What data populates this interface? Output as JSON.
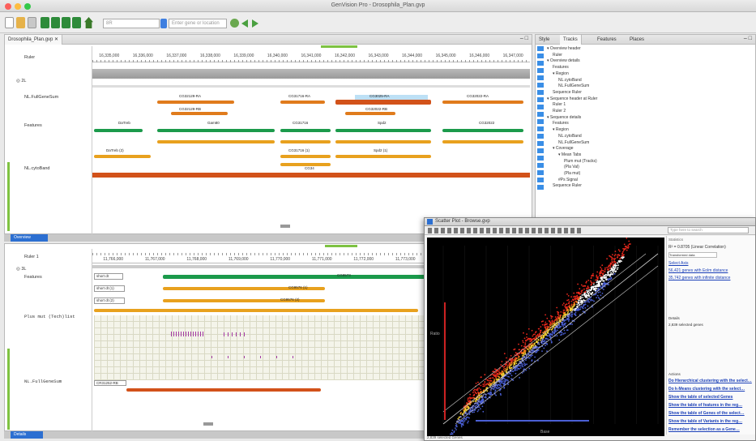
{
  "window": {
    "title": "GenVision Pro - Drosophila_Plan.gvp"
  },
  "toolbar": {
    "search_placeholder": "Enter gene or location",
    "combo_value": "8R"
  },
  "top_panel": {
    "tab_label": "Drosophila_Plan.gvp",
    "ruler_label": "Ruler",
    "chrom_label": "2L",
    "ticks": [
      "16,335,000",
      "16,336,000",
      "16,337,000",
      "16,338,000",
      "16,339,000",
      "16,340,000",
      "16,341,000",
      "16,342,000",
      "16,343,000",
      "16,344,000",
      "16,345,000",
      "16,346,000",
      "16,347,000"
    ],
    "track_labels": {
      "fullgene": "NL.FullGeneSum",
      "features": "Features",
      "cds": "NL.cytoBand"
    },
    "gene_labels": [
      "CG32129-RA",
      "CG32129-RB",
      "CG31716-RA",
      "CG3025-RA",
      "CG32022-RA",
      "CG32022-RB"
    ],
    "feature_labels": [
      "DaTreb",
      "Gam80",
      "CG31716",
      "Spd2",
      "CG32022"
    ],
    "feature_labels2": [
      "DaTreb (2)",
      "Gam80",
      "CG31716 (1)",
      "Spd2 (1)",
      "CG32022"
    ],
    "cds_label": "CG34",
    "status_label": "Overview"
  },
  "bottom_panel": {
    "ruler_label": "Ruler 1",
    "chrom_label": "3L",
    "ticks": [
      "11,766,000",
      "11,767,000",
      "11,768,000",
      "11,769,000",
      "11,770,000",
      "11,771,000",
      "11,772,000",
      "11,773,000"
    ],
    "track_labels": {
      "features": "Features",
      "plus": "Plus mut (Tech)list",
      "cds": "NL.FullGeneSum"
    },
    "feature_rows": [
      "short dt",
      "short dt (1)",
      "short dt (2)"
    ],
    "gene_labels": [
      "CG9573",
      "CG9576 (1)",
      "CG9576 (2)"
    ],
    "cds_label": "CR31252-RB",
    "status_label": "Details"
  },
  "side_panel": {
    "tabs": [
      "Style",
      "Tracks",
      "Features",
      "Places"
    ],
    "tree": [
      "Overview header",
      "Ruler",
      "Overview details",
      "Features",
      "Region",
      "NL.cytoBand",
      "NL.FullGeneSum",
      "Sequence Ruler",
      "Sequence header at Ruler",
      "Ruler 1",
      "Ruler 2",
      "Sequence details",
      "Features",
      "Region",
      "NL.cytoBand",
      "NL.FullGeneSum",
      "Coverage",
      "Mean Tabs",
      "Plum mut (Tracks)",
      "(Pla Val)",
      "(Pla mut)",
      "#Ps Signal",
      "Sequence Ruler"
    ]
  },
  "scatter": {
    "title": "Scatter Plot - Browse.gvp",
    "search_placeholder": "Type here to search",
    "xlabel": "Base",
    "ylabel": "Ratio",
    "panel_header": "Statistics",
    "stats": [
      "R² = 0.8705 (Linear Correlation)",
      "Transformed data",
      "Select Axis",
      "56,421 genes with Eolm distance",
      "35,742 genes with infinite distance"
    ],
    "section2": "Details",
    "section2_text": "2,839 selected genes",
    "section3": "Actions",
    "actions": [
      "Do Hierarchical clustering with the select…",
      "Do k-Means clustering with the select…",
      "Show the table of selected Genes",
      "Show the table of features in the reg…",
      "Show the table of Genes of the select…",
      "Show the table of Variants in the reg…",
      "Remember the selection as a Gene…"
    ],
    "footer": "2,839 selected Genes",
    "accent_red": "#e8281c",
    "accent_blue": "#4a5fd4",
    "accent_yellow": "#f2d033"
  }
}
